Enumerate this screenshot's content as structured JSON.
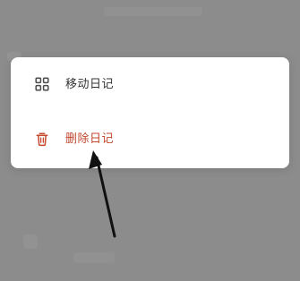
{
  "context_menu": {
    "items": [
      {
        "label": "移动日记",
        "icon": "grid-icon"
      },
      {
        "label": "删除日记",
        "icon": "trash-icon"
      }
    ]
  },
  "colors": {
    "overlay": "#8c8c8c",
    "card": "#ffffff",
    "primary_text": "#333333",
    "danger": "#c4472e"
  },
  "annotation": {
    "icon": "arrow-pointer-icon"
  }
}
